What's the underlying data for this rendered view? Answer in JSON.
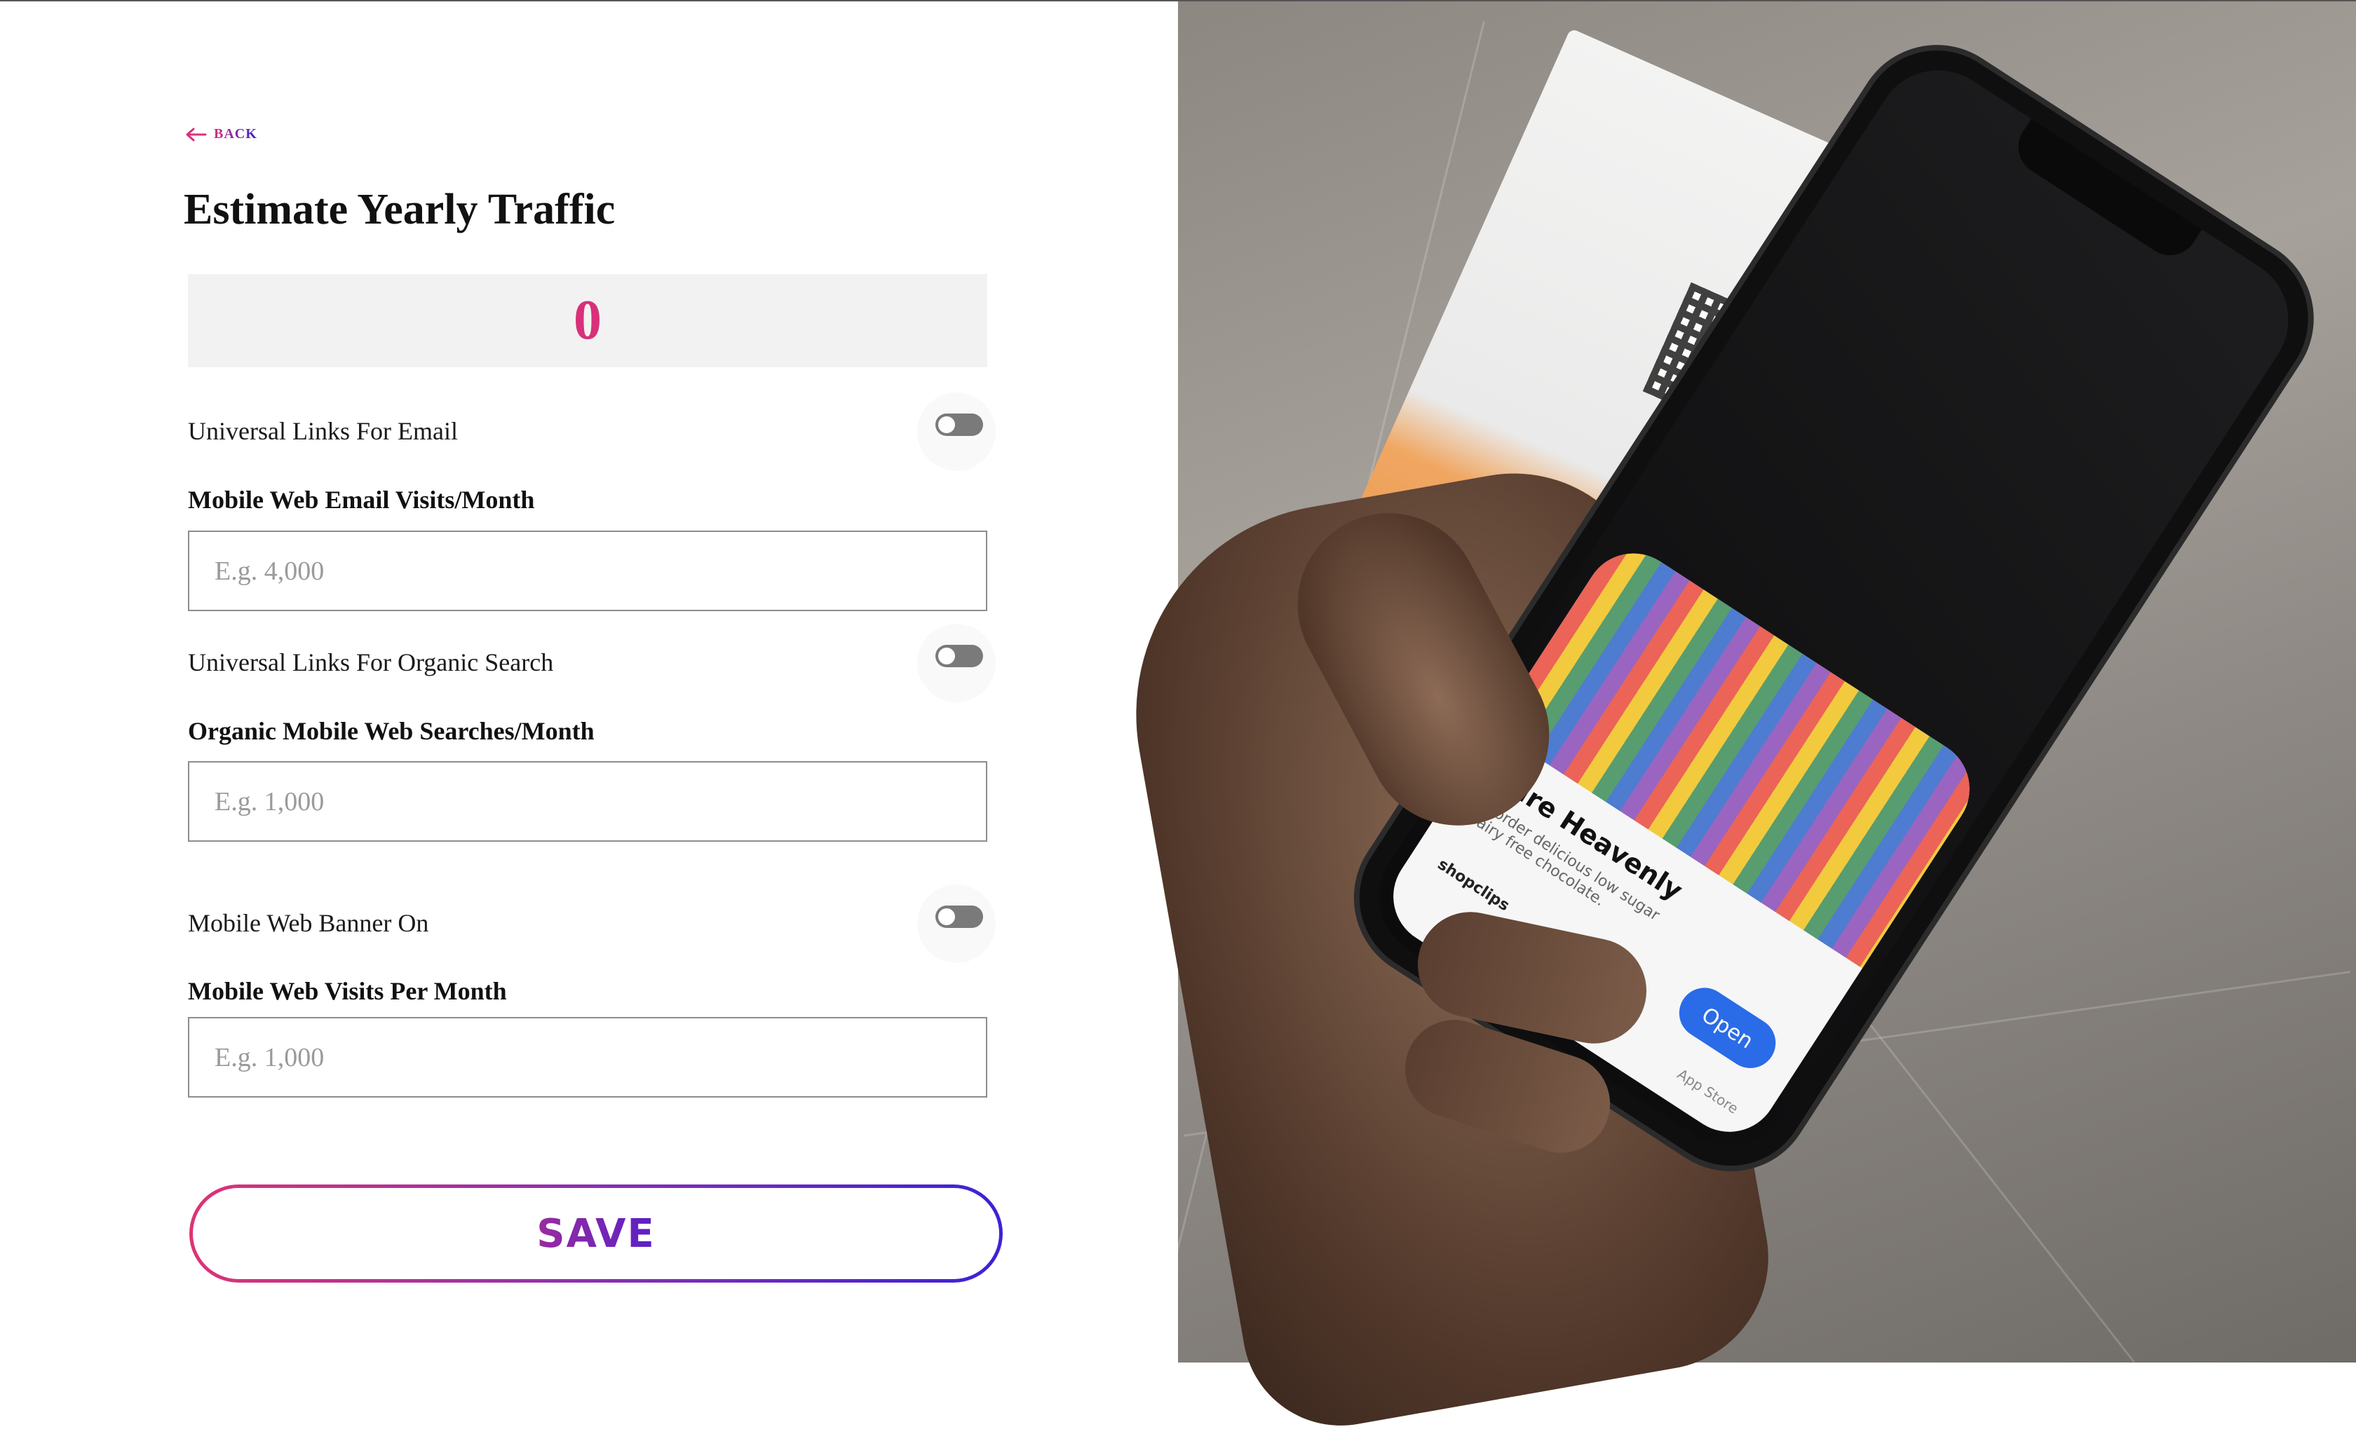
{
  "nav": {
    "back_label": "BACK"
  },
  "page": {
    "title": "Estimate Yearly Traffic",
    "total": "0"
  },
  "toggles": {
    "email": {
      "label": "Universal Links For Email",
      "on": false
    },
    "organic": {
      "label": "Universal Links For Organic Search",
      "on": false
    },
    "banner": {
      "label": "Mobile Web Banner On",
      "on": false
    }
  },
  "fields": {
    "email_visits": {
      "label": "Mobile Web Email Visits/Month",
      "placeholder": "E.g. 4,000",
      "value": ""
    },
    "organic_searches": {
      "label": "Organic Mobile Web Searches/Month",
      "placeholder": "E.g. 1,000",
      "value": ""
    },
    "web_visits": {
      "label": "Mobile Web Visits Per Month",
      "placeholder": "E.g. 1,000",
      "value": ""
    }
  },
  "actions": {
    "save_label": "SAVE"
  },
  "photo": {
    "clip_title": "Pure Heavenly",
    "clip_subtitle": "Reorder delicious low sugar dairy free chocolate.",
    "clip_open": "Open",
    "clip_brand": "shopclips",
    "clip_store": "App Store"
  },
  "colors": {
    "accent_pink": "#d8307a",
    "accent_purple": "#3a1fd0",
    "toggle_off": "#7a7a7a"
  }
}
